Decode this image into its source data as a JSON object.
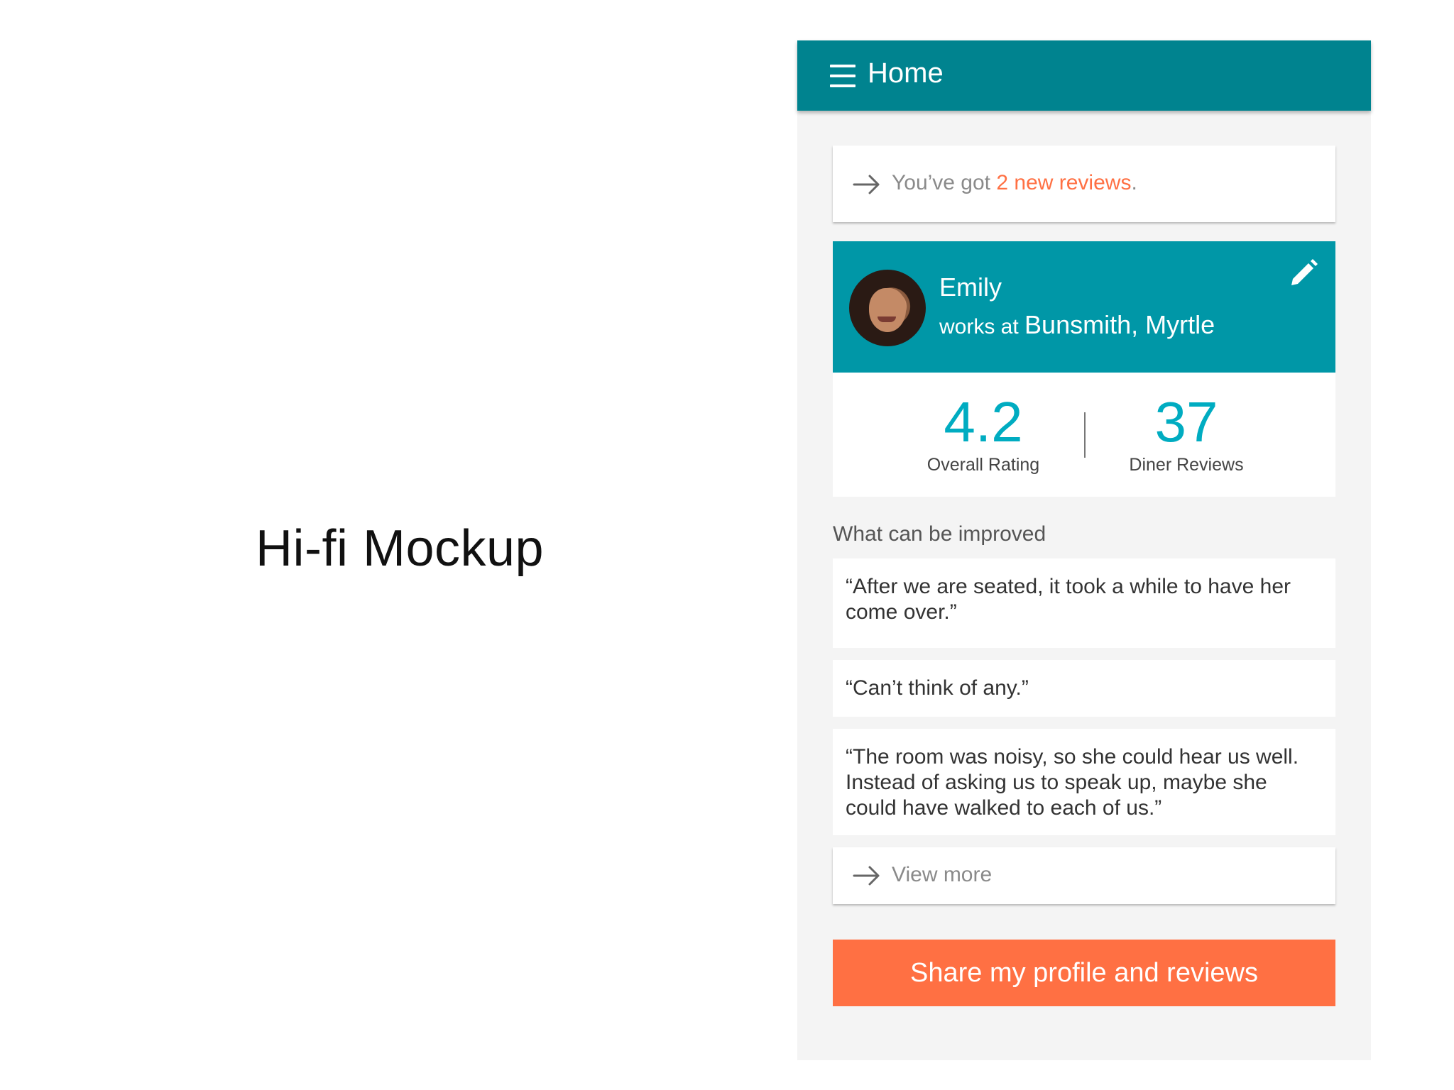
{
  "slide": {
    "title": "Hi-fi Mockup"
  },
  "appbar": {
    "title": "Home",
    "menu_icon": "hamburger-menu-icon",
    "color": "#00838f"
  },
  "notice": {
    "icon": "arrow-right-icon",
    "prefix": "You’ve got ",
    "highlight": "2 new reviews",
    "suffix": "."
  },
  "profile": {
    "name": "Emily",
    "works_at_prefix": "works at ",
    "workplace": "Bunsmith, Myrtle",
    "edit_icon": "pencil-edit-icon",
    "header_color": "#0097a7"
  },
  "stats": [
    {
      "value": "4.2",
      "label": "Overall Rating"
    },
    {
      "value": "37",
      "label": "Diner Reviews"
    }
  ],
  "improvements": {
    "heading": "What can be improved",
    "quotes": [
      "“After we are seated, it took a while to have her come over.”",
      "“Can’t think of any.”",
      "“The room was noisy, so she could hear us well. Instead of asking us to speak up, maybe she could have walked to each of us.”"
    ],
    "view_more_label": "View more"
  },
  "actions": {
    "share_label": "Share my profile and reviews",
    "accent_color": "#ff7043"
  }
}
